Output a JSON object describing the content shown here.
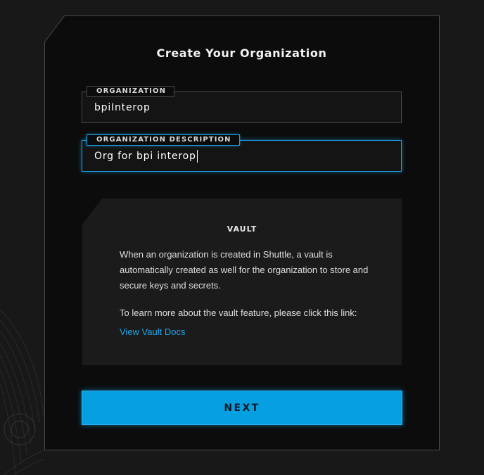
{
  "page": {
    "title": "Create Your Organization"
  },
  "form": {
    "organization": {
      "label": "ORGANIZATION",
      "value": "bpiInterop"
    },
    "description": {
      "label": "ORGANIZATION DESCRIPTION",
      "value": "Org for bpi interop"
    }
  },
  "vault": {
    "title": "VAULT",
    "body": "When an organization is created in Shuttle, a vault is automatically created as well for the organization to store and secure keys and secrets.",
    "learn_more": "To learn more about the vault feature, please click this link:",
    "link_label": "View Vault Docs"
  },
  "actions": {
    "next_label": "NEXT"
  },
  "colors": {
    "accent": "#1ea4e9",
    "button": "#06a0e2",
    "panel": "#0c0c0c",
    "background": "#181818"
  }
}
